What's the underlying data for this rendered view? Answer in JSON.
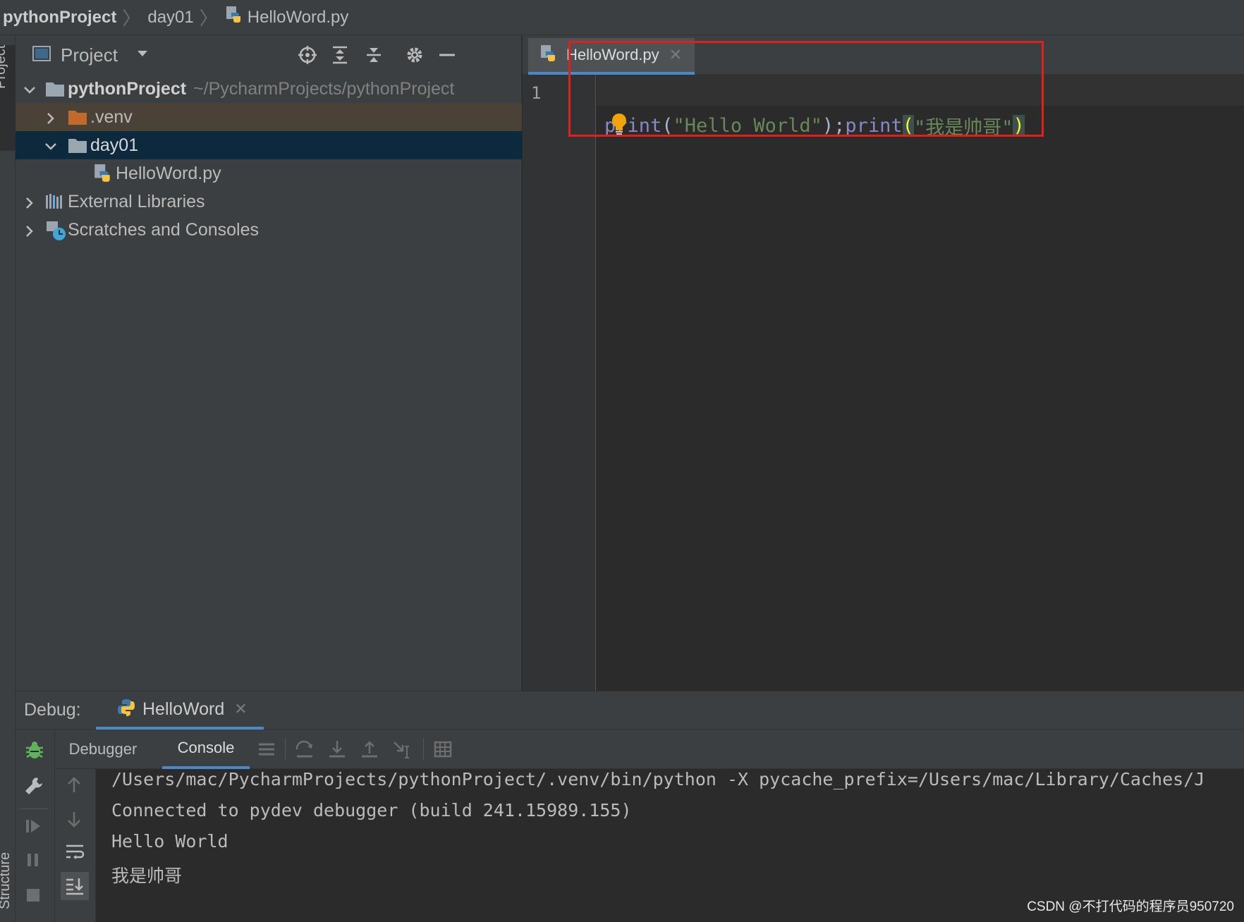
{
  "breadcrumb": {
    "project": "pythonProject",
    "folder": "day01",
    "file": "HelloWord.py"
  },
  "left_strip": {
    "project_label": "Project",
    "structure_label": "Structure"
  },
  "project_panel": {
    "title": "Project",
    "tree": {
      "root_name": "pythonProject",
      "root_path": "~/PycharmProjects/pythonProject",
      "venv": ".venv",
      "day01": "day01",
      "file": "HelloWord.py",
      "external_libraries": "External Libraries",
      "scratches": "Scratches and Consoles"
    }
  },
  "editor": {
    "tab_label": "HelloWord.py",
    "line_number": "1",
    "code": {
      "kw1": "print",
      "p1": "(",
      "s1": "\"Hello World\"",
      "p2": ");",
      "kw2": "print",
      "p3": "(",
      "s2": "\"我是帅哥\"",
      "p4": ")"
    }
  },
  "debug": {
    "label": "Debug:",
    "run_tab": "HelloWord",
    "tabs": {
      "debugger": "Debugger",
      "console": "Console"
    },
    "console_lines": [
      "/Users/mac/PycharmProjects/pythonProject/.venv/bin/python -X pycache_prefix=/Users/mac/Library/Caches/J",
      "Connected to pydev debugger (build 241.15989.155)",
      "Hello World",
      "我是帅哥"
    ]
  },
  "watermark": "CSDN @不打代码的程序员950720",
  "colors": {
    "accent": "#4a88c7",
    "annotation_red": "#e0201b",
    "keyword": "#8888c6",
    "string": "#6a8759"
  }
}
